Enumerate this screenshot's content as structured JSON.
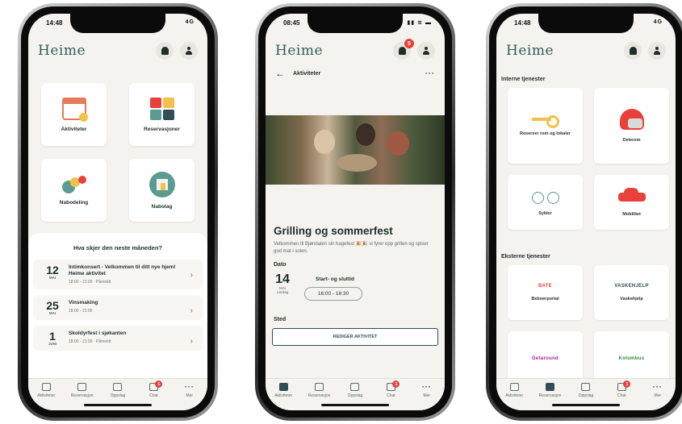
{
  "phone1": {
    "status": {
      "time": "14:48",
      "signal": "4G"
    },
    "logo": "Heime",
    "tiles": [
      {
        "label": "Aktiviteter",
        "icon": "calendar-icon"
      },
      {
        "label": "Reservasjoner",
        "icon": "reservations-icon"
      },
      {
        "label": "Nabodeling",
        "icon": "sharing-icon"
      },
      {
        "label": "Nabolag",
        "icon": "neighborhood-icon"
      }
    ],
    "events_title": "Hva skjer den neste måneden?",
    "events": [
      {
        "day": "12",
        "month": "MAI",
        "title": "Intimkonsert - Velkommen til ditt nye hjem! Heime aktivitet",
        "meta": "18:00 - 21:00 · Påmeldt"
      },
      {
        "day": "25",
        "month": "MAI",
        "title": "Vinsmaking",
        "meta": "18:00 - 21:00"
      },
      {
        "day": "1",
        "month": "JUNI",
        "title": "Skoldyrfest i sjøkanten",
        "meta": "18:00 - 21:00 · Påmeldt"
      }
    ],
    "tabs": [
      "Aktiviteter",
      "Reservasjon",
      "Oppslag",
      "Chat",
      "Mer"
    ],
    "chat_badge": "1"
  },
  "phone2": {
    "status": {
      "time": "08:45"
    },
    "logo": "Heime",
    "bell_badge": "5",
    "subtitle": "Aktiviteter",
    "more": "···",
    "title": "Grilling og sommerfest",
    "description": "Velkommen til Bjøndalen sin hagefest 🎉🎉 vi fyrer opp grillen og spiser god mat i solen.",
    "date_label": "Dato",
    "date_day": "14",
    "date_month": "MAI",
    "date_weekday": "Lørdag",
    "time_label": "Start- og sluttid",
    "time_value": "16:00 - 18:30",
    "place_label": "Sted",
    "edit_button": "REDIGER AKTIVITET",
    "tabs": [
      "Aktiviteter",
      "Reservasjon",
      "Oppslag",
      "Chat",
      "Mer"
    ],
    "chat_badge": "1"
  },
  "phone3": {
    "status": {
      "time": "14:48",
      "signal": "4G"
    },
    "logo": "Heime",
    "internal_header": "Interne tjenester",
    "internal": [
      {
        "label": "Reserver rom og lokaler",
        "icon": "key-icon"
      },
      {
        "label": "Delerom",
        "icon": "helmet-icon"
      },
      {
        "label": "Sykler",
        "icon": "bike-icon"
      },
      {
        "label": "Mobilitet",
        "icon": "car-icon"
      }
    ],
    "external_header": "Eksterne tjenester",
    "external": [
      {
        "label": "Beboerportal",
        "brand": "BATE",
        "brand_color": "#e8413c"
      },
      {
        "label": "Vaskehjelp",
        "brand": "VASKEHJELP",
        "brand_color": "#2f4f54"
      },
      {
        "label": "",
        "brand": "Getaround",
        "brand_color": "#b01e8e"
      },
      {
        "label": "",
        "brand": "Kolumbus",
        "brand_color": "#2e8a3c"
      }
    ],
    "tabs": [
      "Aktiviteter",
      "Reservasjon",
      "Oppslag",
      "Chat",
      "Mer"
    ],
    "chat_badge": "1"
  },
  "colors": {
    "accent": "#2f5f5a",
    "red": "#e8413c",
    "yellow": "#f4c04c",
    "teal": "#5b9b91",
    "background": "#f5f3ef"
  }
}
